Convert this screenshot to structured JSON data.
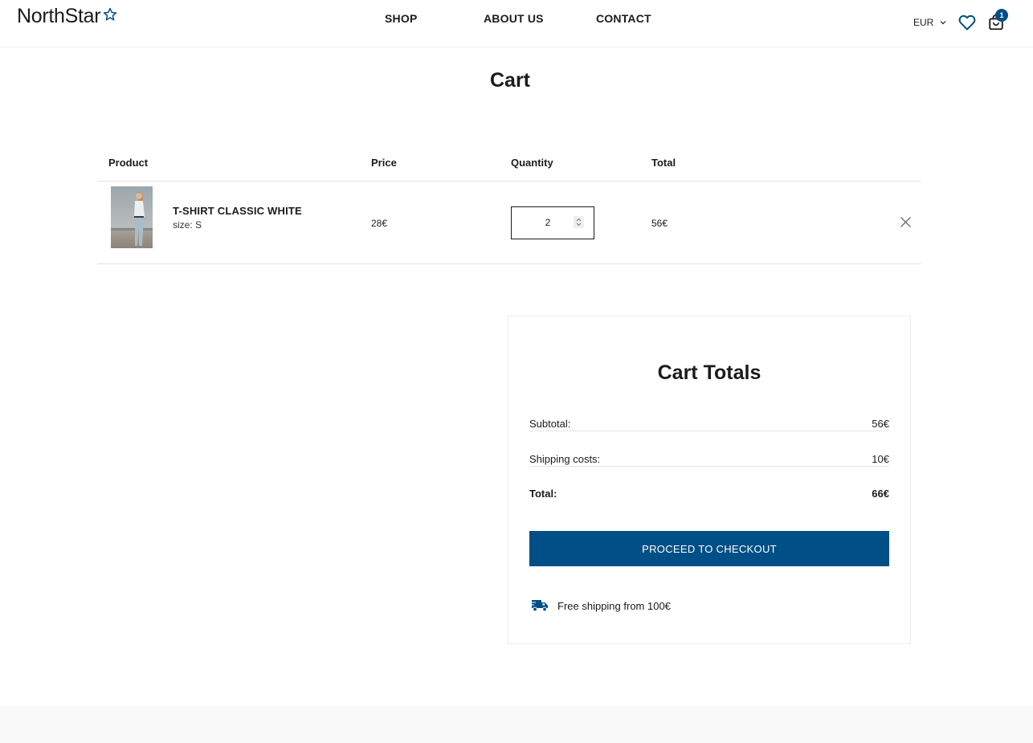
{
  "brand": {
    "name": "NorthStar"
  },
  "nav": {
    "items": [
      "SHOP",
      "ABOUT US",
      "CONTACT"
    ]
  },
  "header": {
    "currency": "EUR",
    "cart_count": "1"
  },
  "page": {
    "title": "Cart"
  },
  "table": {
    "headers": [
      "Product",
      "Price",
      "Quantity",
      "Total"
    ],
    "rows": [
      {
        "name": "T-SHIRT CLASSIC WHITE",
        "size": "size: S",
        "price": "28€",
        "quantity": "2",
        "total": "56€"
      }
    ]
  },
  "totals": {
    "title": "Cart Totals",
    "subtotal_label": "Subtotal:",
    "subtotal_value": "56€",
    "shipping_label": "Shipping costs:",
    "shipping_value": "10€",
    "total_label": "Total:",
    "total_value": "66€",
    "checkout_label": "PROCEED TO CHECKOUT",
    "free_shipping": "Free shipping from 100€"
  },
  "colors": {
    "accent": "#004f86",
    "text": "#1b1b1b",
    "divider": "#e6e6e6"
  }
}
